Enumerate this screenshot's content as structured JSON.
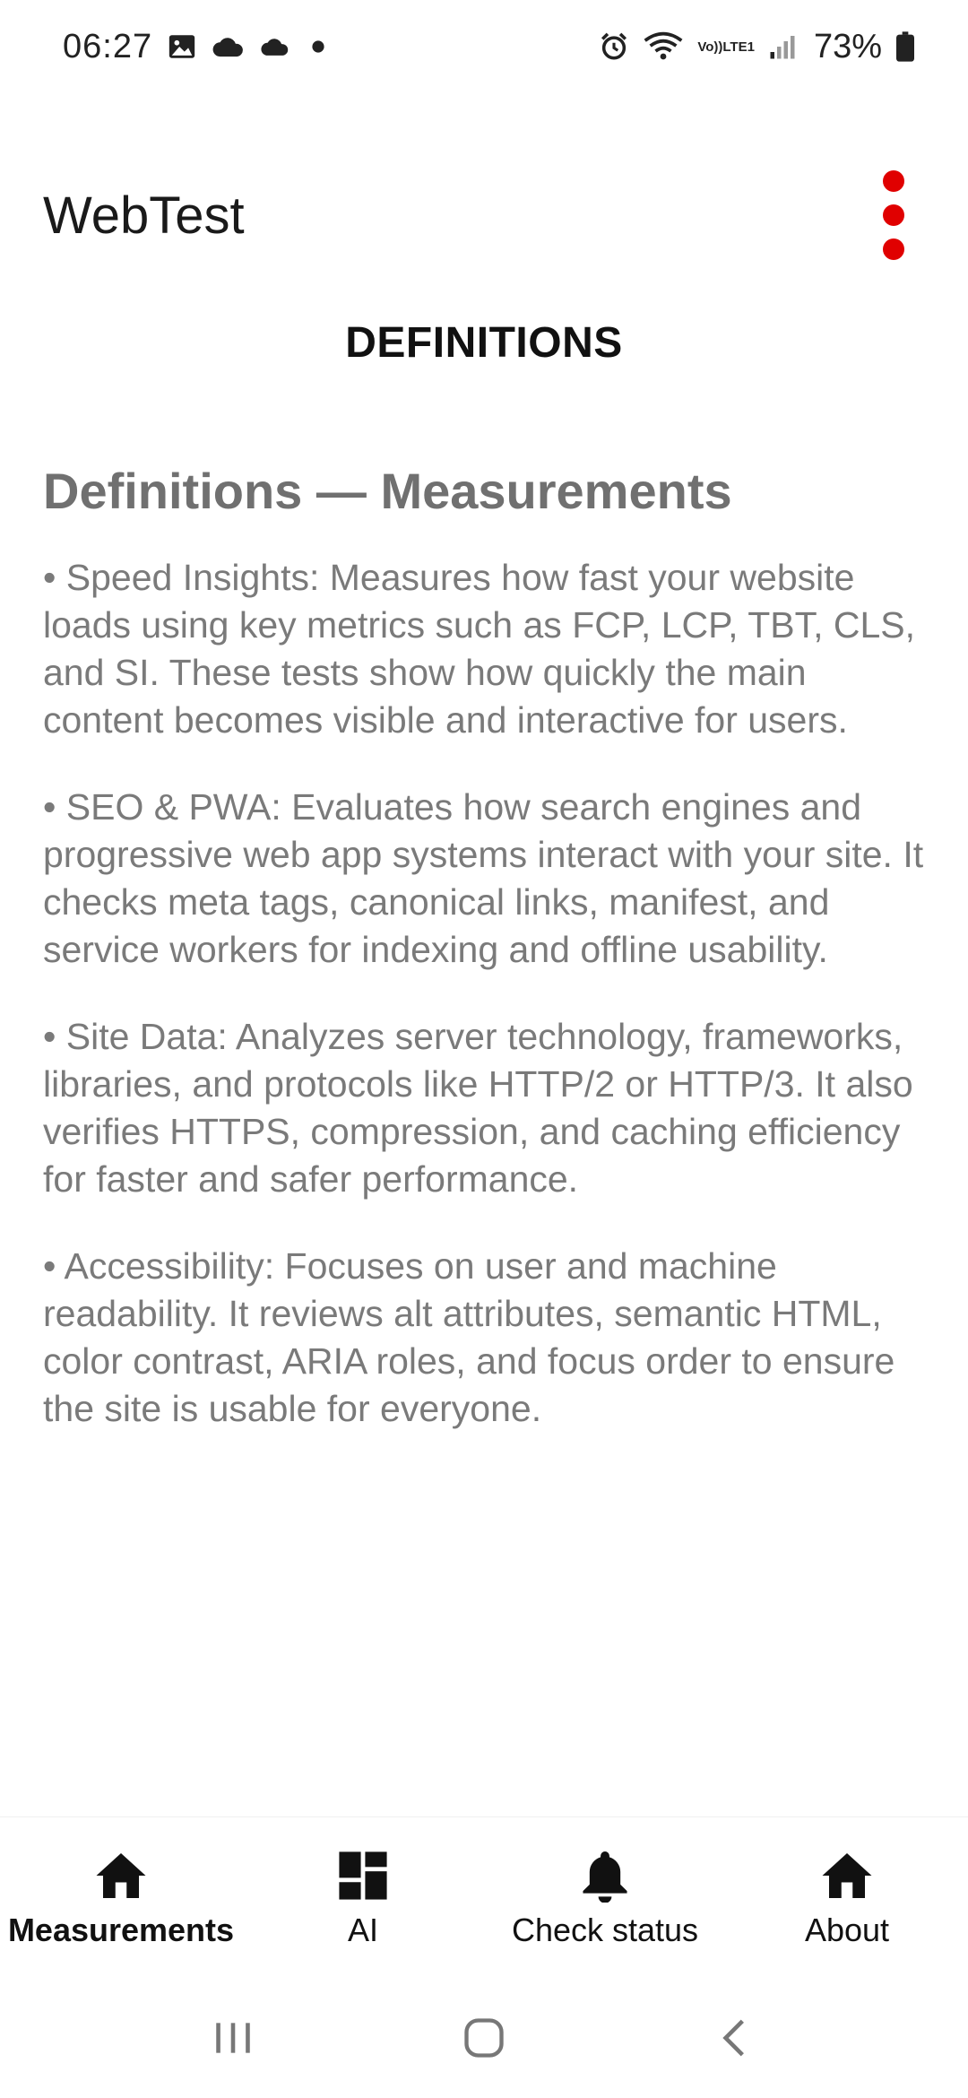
{
  "status_bar": {
    "time": "06:27",
    "battery": "73%",
    "lte_top": "Vo))",
    "lte_bottom": "LTE1",
    "left_icons": [
      "image-icon",
      "cloud-icon",
      "cloud-icon",
      "dot-icon"
    ],
    "right_icons": [
      "alarm-icon",
      "wifi-icon",
      "lte-icon",
      "signal-icon",
      "battery-icon"
    ]
  },
  "app_bar": {
    "title": "WebTest",
    "menu_icon": "more-vertical-icon",
    "menu_color": "#e00000"
  },
  "section": {
    "header": "DEFINITIONS"
  },
  "content": {
    "title": "Definitions — Measurements",
    "paragraphs": [
      "• Speed Insights: Measures how fast your website loads using key metrics such as FCP, LCP, TBT, CLS, and SI. These tests show how quickly the main content becomes visible and interactive for users.",
      "• SEO & PWA: Evaluates how search engines and progressive web app systems interact with your site. It checks meta tags, canonical links, manifest, and service workers for indexing and offline usability.",
      "• Site Data: Analyzes server technology, frameworks, libraries, and protocols like HTTP/2 or HTTP/3. It also verifies HTTPS, compression, and caching efficiency for faster and safer performance.",
      "• Accessibility: Focuses on user and machine readability. It reviews alt attributes, semantic HTML, color contrast, ARIA roles, and focus order to ensure the site is usable for everyone."
    ]
  },
  "bottom_nav": {
    "items": [
      {
        "label": "Measurements",
        "icon": "home-icon",
        "active": true
      },
      {
        "label": "AI",
        "icon": "dashboard-icon",
        "active": false
      },
      {
        "label": "Check status",
        "icon": "bell-icon",
        "active": false
      },
      {
        "label": "About",
        "icon": "home-icon",
        "active": false
      }
    ]
  },
  "system_nav": {
    "icons": [
      "recents-icon",
      "home-button-icon",
      "back-icon"
    ]
  }
}
